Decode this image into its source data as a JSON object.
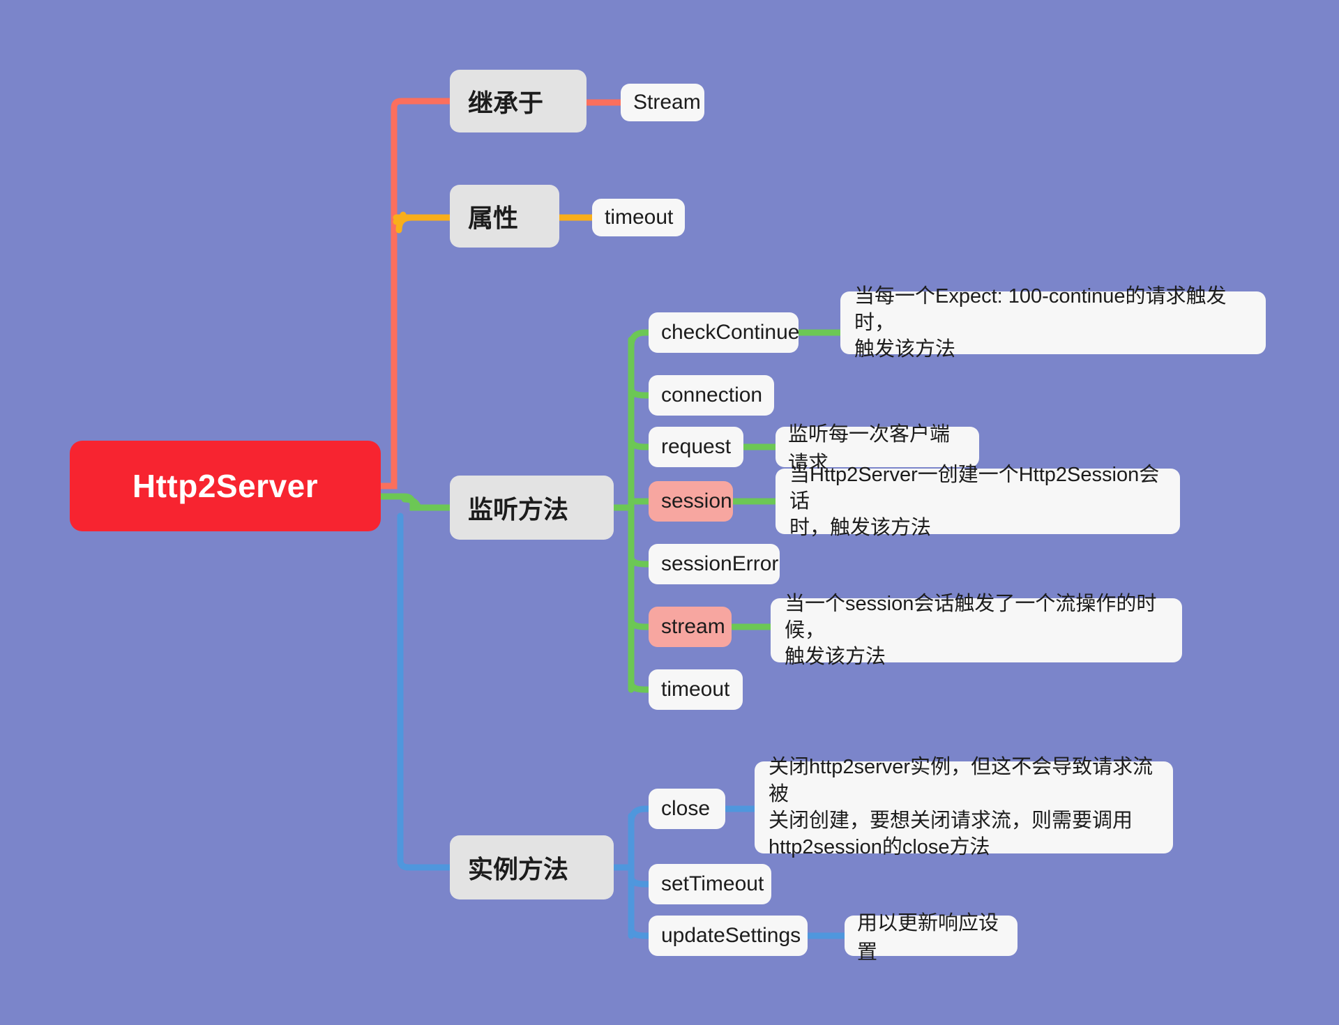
{
  "theme": {
    "background": "#7b85ca",
    "root_fill": "#f72430",
    "root_text": "#ffffff",
    "category_fill": "#e3e3e3",
    "leaf_fill": "#f7f7f7",
    "highlight_fill": "#f7a6a0",
    "text_color": "#1c1c1c",
    "wire_red": "#fb6f5d",
    "wire_orange": "#f9ae1b",
    "wire_green": "#6cc755",
    "wire_blue": "#4f97dd"
  },
  "root": {
    "label": "Http2Server"
  },
  "branches": [
    {
      "id": "inherit",
      "label": "继承于",
      "color": "#fb6f5d",
      "children": [
        {
          "id": "stream",
          "label": "Stream",
          "highlight": false,
          "description": null
        }
      ]
    },
    {
      "id": "properties",
      "label": "属性",
      "color": "#f9ae1b",
      "children": [
        {
          "id": "timeout-prop",
          "label": "timeout",
          "highlight": false,
          "description": null
        }
      ]
    },
    {
      "id": "listen-methods",
      "label": "监听方法",
      "color": "#6cc755",
      "children": [
        {
          "id": "checkContinue",
          "label": "checkContinue",
          "highlight": false,
          "description": "当每一个Expect: 100-continue的请求触发时，\n触发该方法"
        },
        {
          "id": "connection",
          "label": "connection",
          "highlight": false,
          "description": null
        },
        {
          "id": "request",
          "label": "request",
          "highlight": false,
          "description": "监听每一次客户端请求"
        },
        {
          "id": "session",
          "label": "session",
          "highlight": true,
          "description": "当Http2Server一创建一个Http2Session会话\n时，触发该方法"
        },
        {
          "id": "sessionError",
          "label": "sessionError",
          "highlight": false,
          "description": null
        },
        {
          "id": "stream-event",
          "label": "stream",
          "highlight": true,
          "description": "当一个session会话触发了一个流操作的时候，\n触发该方法"
        },
        {
          "id": "timeout-event",
          "label": "timeout",
          "highlight": false,
          "description": null
        }
      ]
    },
    {
      "id": "instance-methods",
      "label": "实例方法",
      "color": "#4f97dd",
      "children": [
        {
          "id": "close",
          "label": "close",
          "highlight": false,
          "description": "关闭http2server实例，但这不会导致请求流被\n关闭创建，要想关闭请求流，则需要调用\nhttp2session的close方法"
        },
        {
          "id": "setTimeout",
          "label": "setTimeout",
          "highlight": false,
          "description": null
        },
        {
          "id": "updateSettings",
          "label": "updateSettings",
          "highlight": false,
          "description": "用以更新响应设置"
        }
      ]
    }
  ]
}
